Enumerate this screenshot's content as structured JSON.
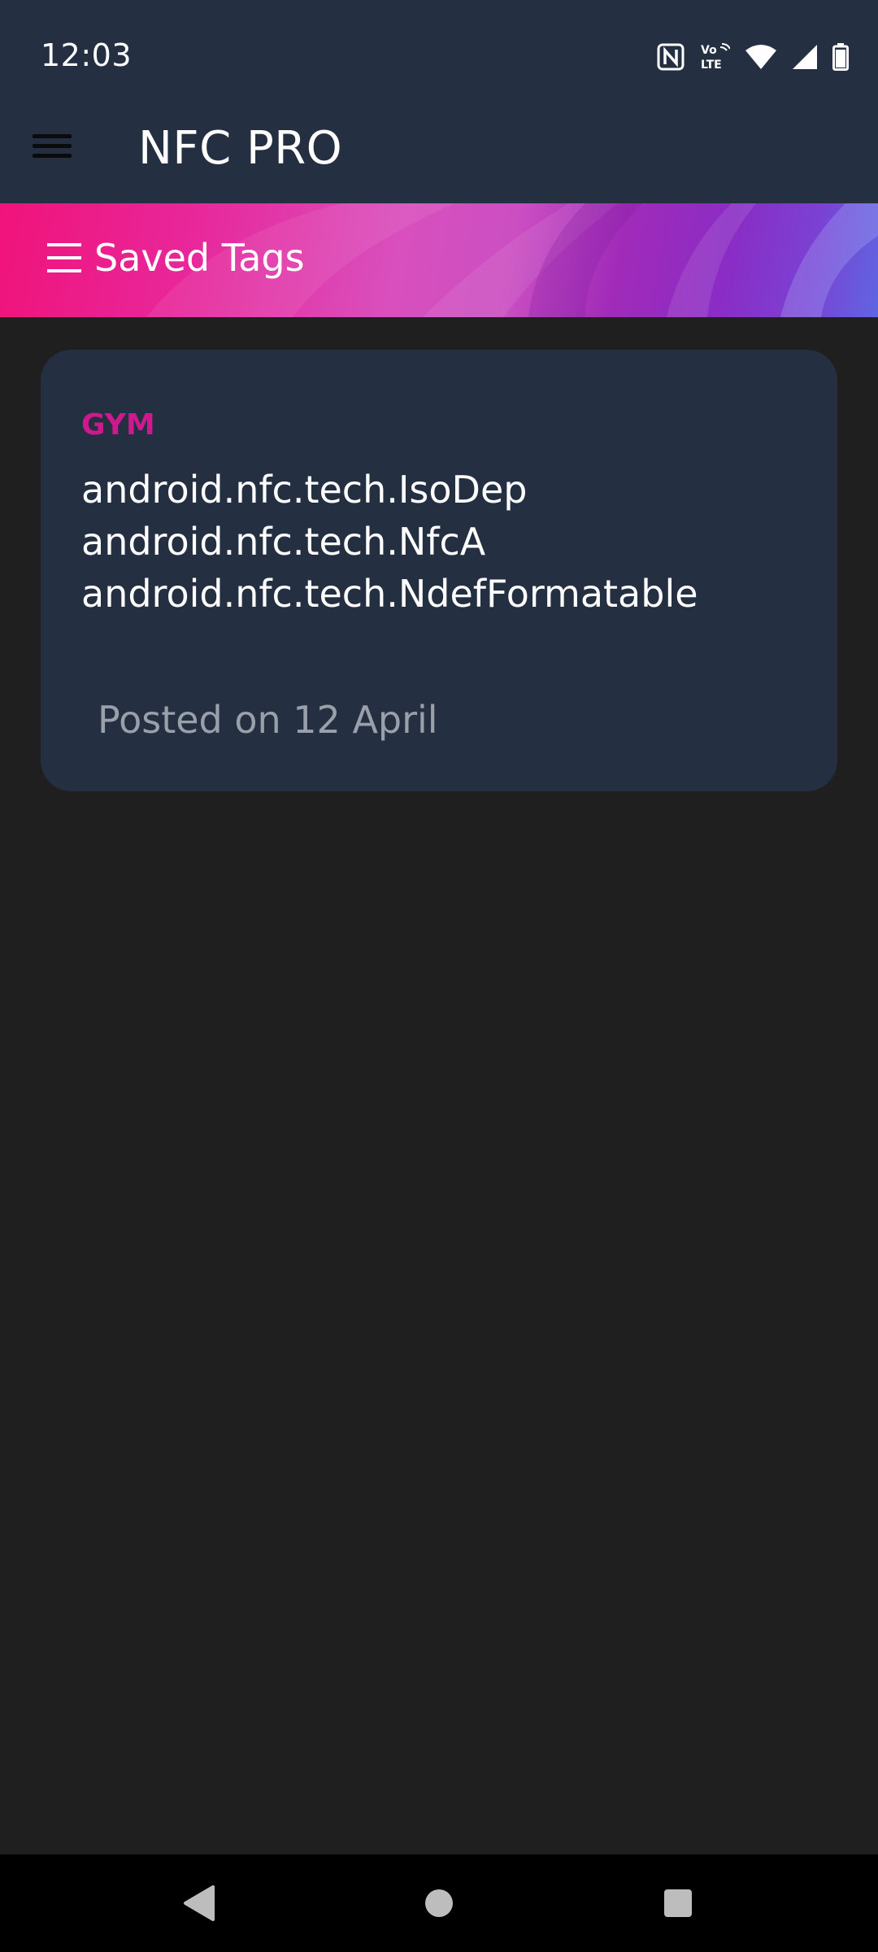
{
  "status_bar": {
    "time": "12:03",
    "icons": [
      "nfc-icon",
      "volte-icon",
      "wifi-icon",
      "signal-icon",
      "battery-icon"
    ],
    "volte_label_top": "Vo",
    "volte_label_bottom": "LTE"
  },
  "app_bar": {
    "title": "NFC PRO"
  },
  "banner": {
    "title": "Saved Tags"
  },
  "saved_tags": [
    {
      "name": "GYM",
      "techs": [
        "android.nfc.tech.IsoDep",
        "android.nfc.tech.NfcA",
        "android.nfc.tech.NdefFormatable"
      ],
      "posted": "Posted on 12 April"
    }
  ],
  "colors": {
    "app_bar": "#252f42",
    "background": "#1f1f1f",
    "card": "#252f42",
    "tag_accent": "#d0188e",
    "posted_text": "#9aa0aa"
  }
}
